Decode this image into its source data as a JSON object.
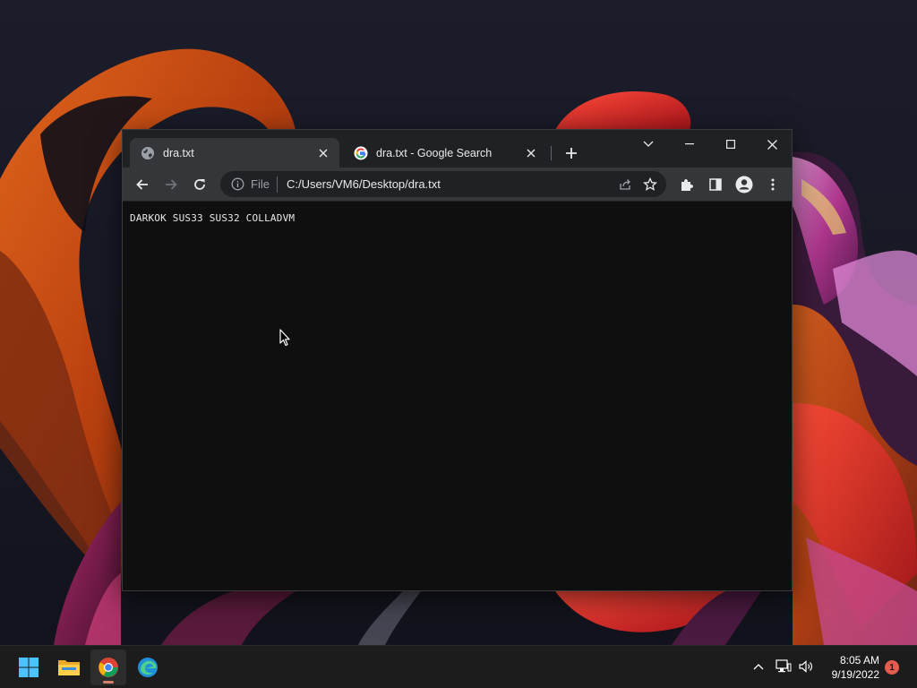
{
  "browser": {
    "tabs": [
      {
        "title": "dra.txt",
        "favicon": "globe-icon",
        "active": true
      },
      {
        "title": "dra.txt - Google Search",
        "favicon": "google-icon",
        "active": false
      }
    ],
    "address_bar": {
      "scheme_label": "File",
      "url": "C:/Users/VM6/Desktop/dra.txt"
    },
    "page_text": "DARKOK SUS33 SUS32 COLLADVM"
  },
  "taskbar": {
    "apps": [
      "windows-start",
      "file-explorer",
      "google-chrome",
      "microsoft-edge"
    ],
    "clock": {
      "time": "8:05 AM",
      "date": "9/19/2022"
    },
    "notification_count": "1"
  },
  "colors": {
    "titlebar": "#202124",
    "toolbar": "#35363a",
    "page_background": "#0f0f0f",
    "taskbar": "#1c1c1c",
    "notification_badge": "#e55b4d"
  }
}
